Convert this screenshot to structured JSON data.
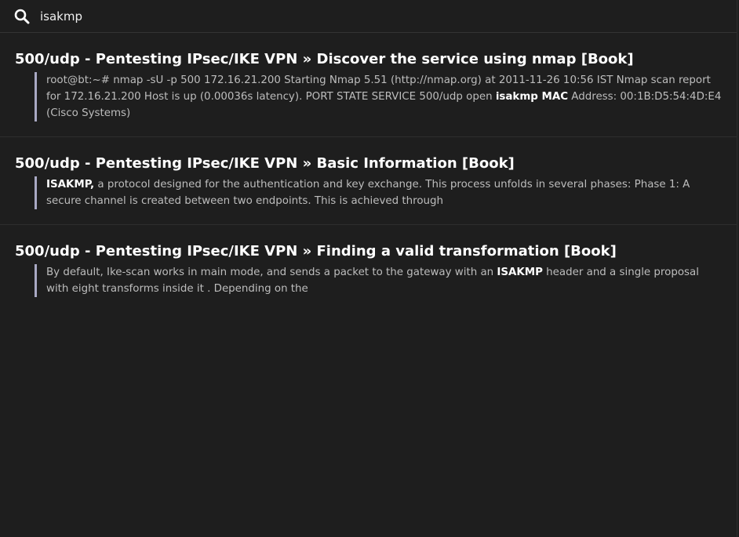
{
  "search": {
    "value": "isakmp",
    "placeholder": "",
    "icon": "search-icon"
  },
  "results": [
    {
      "title": "500/udp - Pentesting IPsec/IKE VPN » Discover the service using nmap [Book]",
      "excerpt": [
        {
          "text": "root@bt:~# nmap -sU -p 500 172.16.21.200 Starting Nmap 5.51 (http://nmap.org) at 2011-11-26 10:56 IST Nmap scan report for 172.16.21.200 Host is up (0.00036s latency). PORT STATE SERVICE 500/udp open ",
          "highlight": false
        },
        {
          "text": "isakmp MAC",
          "highlight": true
        },
        {
          "text": " Address: 00:1B:D5:54:4D:E4 (Cisco Systems)",
          "highlight": false
        }
      ]
    },
    {
      "title": "500/udp - Pentesting IPsec/IKE VPN » Basic Information [Book]",
      "excerpt": [
        {
          "text": "ISAKMP,",
          "highlight": true
        },
        {
          "text": " a protocol designed for the authentication and key exchange. This process unfolds in several phases: Phase 1: A secure channel is created between two endpoints. This is achieved through",
          "highlight": false
        }
      ]
    },
    {
      "title": "500/udp - Pentesting IPsec/IKE VPN » Finding a valid transformation [Book]",
      "excerpt": [
        {
          "text": "By default, Ike-scan works in main mode, and sends a packet to the gateway with an ",
          "highlight": false
        },
        {
          "text": "ISAKMP",
          "highlight": true
        },
        {
          "text": " header and a single proposal with eight transforms inside it . Depending on the",
          "highlight": false
        }
      ]
    }
  ],
  "colors": {
    "background": "#1e1e1e",
    "title": "#ffffff",
    "excerpt": "#bdbdbd",
    "highlight": "#ffffff",
    "quote_bar": "#a9a9c4",
    "divider": "#2e2e2e"
  }
}
